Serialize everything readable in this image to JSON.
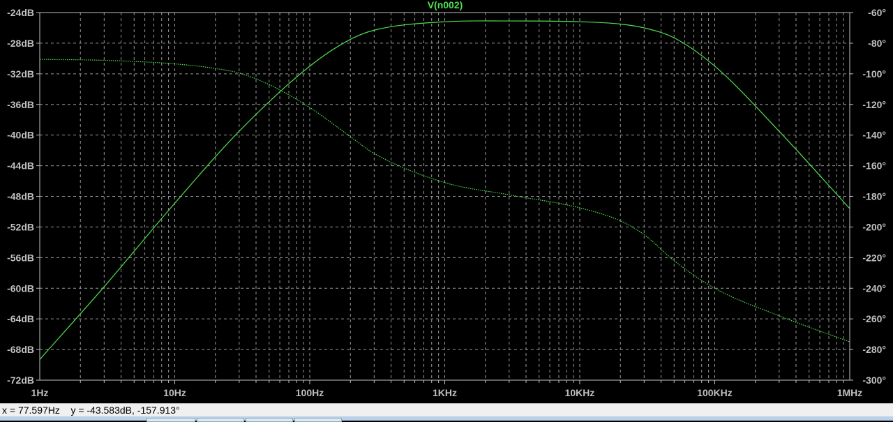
{
  "chart_data": {
    "type": "line",
    "title": "V(n002)",
    "xscale": "log",
    "xlim": [
      1,
      1000000
    ],
    "x_ticks": [
      "1Hz",
      "10Hz",
      "100Hz",
      "1KHz",
      "10KHz",
      "100KHz",
      "1MHz"
    ],
    "y_left": {
      "label": "dB",
      "ylim": [
        -72,
        -24
      ],
      "ticks": [
        "-24dB",
        "-28dB",
        "-32dB",
        "-36dB",
        "-40dB",
        "-44dB",
        "-48dB",
        "-52dB",
        "-56dB",
        "-60dB",
        "-64dB",
        "-68dB",
        "-72dB"
      ]
    },
    "y_right": {
      "label": "degrees",
      "ylim": [
        -300,
        -60
      ],
      "ticks": [
        "-60°",
        "-80°",
        "-100°",
        "-120°",
        "-140°",
        "-160°",
        "-180°",
        "-200°",
        "-220°",
        "-240°",
        "-260°",
        "-280°",
        "-300°"
      ]
    },
    "grid": true,
    "series": [
      {
        "name": "magnitude",
        "axis": "left",
        "style": "solid",
        "color": "#4fe04f",
        "x": [
          1,
          3,
          10,
          30,
          100,
          200,
          300,
          1000,
          3000,
          10000,
          20000,
          30000,
          50000,
          100000,
          300000,
          1000000
        ],
        "y": [
          -69.3,
          -59.8,
          -48.9,
          -39.5,
          -31.0,
          -27.5,
          -26.3,
          -25.2,
          -25.1,
          -25.2,
          -25.5,
          -26.0,
          -27.3,
          -31.0,
          -39.5,
          -49.6
        ]
      },
      {
        "name": "phase",
        "axis": "right",
        "style": "dotted",
        "color": "#4fe04f",
        "x": [
          1,
          3,
          10,
          20,
          30,
          50,
          100,
          200,
          300,
          1000,
          3000,
          10000,
          20000,
          30000,
          50000,
          100000,
          300000,
          1000000
        ],
        "y": [
          -90.5,
          -91.2,
          -93.5,
          -96.5,
          -99.5,
          -107,
          -122,
          -141,
          -152,
          -171,
          -179,
          -187.5,
          -196,
          -205,
          -222,
          -240,
          -258,
          -275
        ]
      }
    ]
  },
  "status": {
    "cursor": "x = 77.597Hz    y = -43.583dB, -157.913°"
  },
  "colors": {
    "background": "#000000",
    "trace": "#4fe04f",
    "axis_text": "#c0c0c0",
    "grid": "#9a9a9a"
  }
}
